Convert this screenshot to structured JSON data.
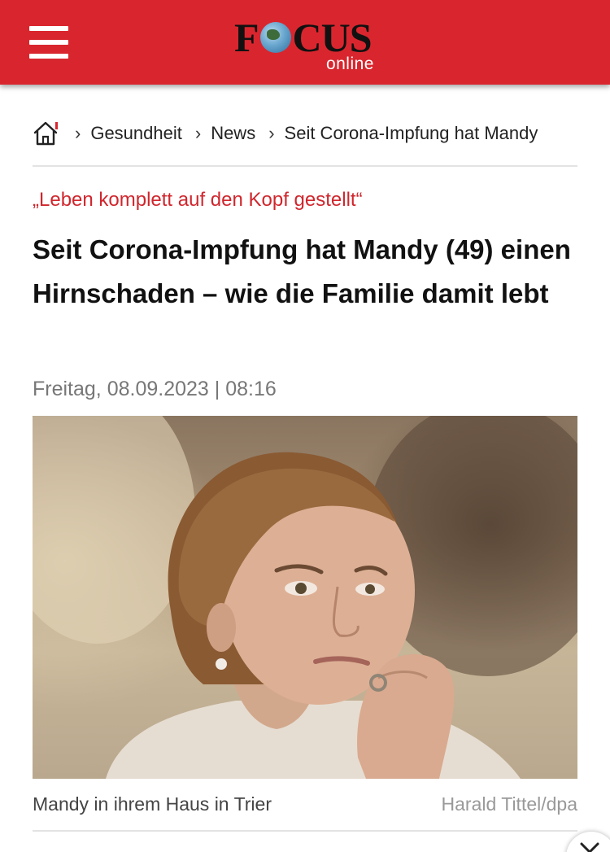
{
  "header": {
    "menu_icon": "hamburger-menu-icon",
    "logo_text": "FOCUS",
    "logo_sub": "online",
    "brand_color": "#d9262e"
  },
  "breadcrumb": {
    "home_icon": "home-icon",
    "items": [
      "Gesundheit",
      "News",
      "Seit Corona-Impfung hat Mandy"
    ]
  },
  "article": {
    "kicker": "„Leben komplett auf den Kopf gestellt“",
    "kicker_color": "#d0262d",
    "headline": "Seit Corona-Impfung hat Mandy (49) einen Hirnschaden – wie die Familie damit lebt",
    "date": "Freitag, 08.09.2023 | 08:16",
    "image": {
      "caption": "Mandy in ihrem Haus in Trier",
      "credit": "Harald Tittel/dpa"
    }
  },
  "overlay": {
    "close_icon": "chevron-down-icon"
  }
}
